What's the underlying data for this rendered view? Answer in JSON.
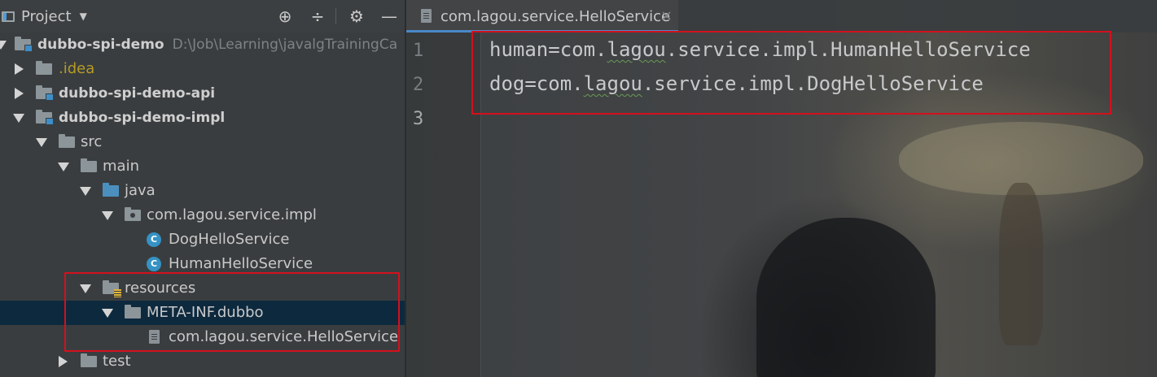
{
  "project_panel": {
    "title": "Project",
    "tree": [
      {
        "label": "dubbo-spi-demo",
        "path": "D:\\Job\\Learning\\javalgTrainingCa",
        "kind": "module-root"
      },
      {
        "label": ".idea",
        "kind": "folder"
      },
      {
        "label": "dubbo-spi-demo-api",
        "kind": "module"
      },
      {
        "label": "dubbo-spi-demo-impl",
        "kind": "module"
      },
      {
        "label": "src",
        "kind": "folder"
      },
      {
        "label": "main",
        "kind": "folder"
      },
      {
        "label": "java",
        "kind": "source-folder"
      },
      {
        "label": "com.lagou.service.impl",
        "kind": "package"
      },
      {
        "label": "DogHelloService",
        "kind": "class"
      },
      {
        "label": "HumanHelloService",
        "kind": "class"
      },
      {
        "label": "resources",
        "kind": "resources-folder"
      },
      {
        "label": "META-INF.dubbo",
        "kind": "folder",
        "selected": true
      },
      {
        "label": "com.lagou.service.HelloService",
        "kind": "file"
      },
      {
        "label": "test",
        "kind": "folder"
      }
    ]
  },
  "editor": {
    "tab": {
      "label": "com.lagou.service.HelloService",
      "close": "×"
    },
    "line_numbers": [
      "1",
      "2",
      "3"
    ],
    "lines": [
      {
        "prefix": "human=com.",
        "typo": "lagou",
        "suffix": ".service.impl.HumanHelloService"
      },
      {
        "prefix": "dog=com.",
        "typo": "lagou",
        "suffix": ".service.impl.DogHelloService"
      },
      {
        "prefix": "",
        "typo": "",
        "suffix": ""
      }
    ]
  },
  "colors": {
    "highlight_box": "#d3101e",
    "selected_row": "#0d293e",
    "class_icon": "#3592c4",
    "idea_folder_text": "#b59b27"
  }
}
